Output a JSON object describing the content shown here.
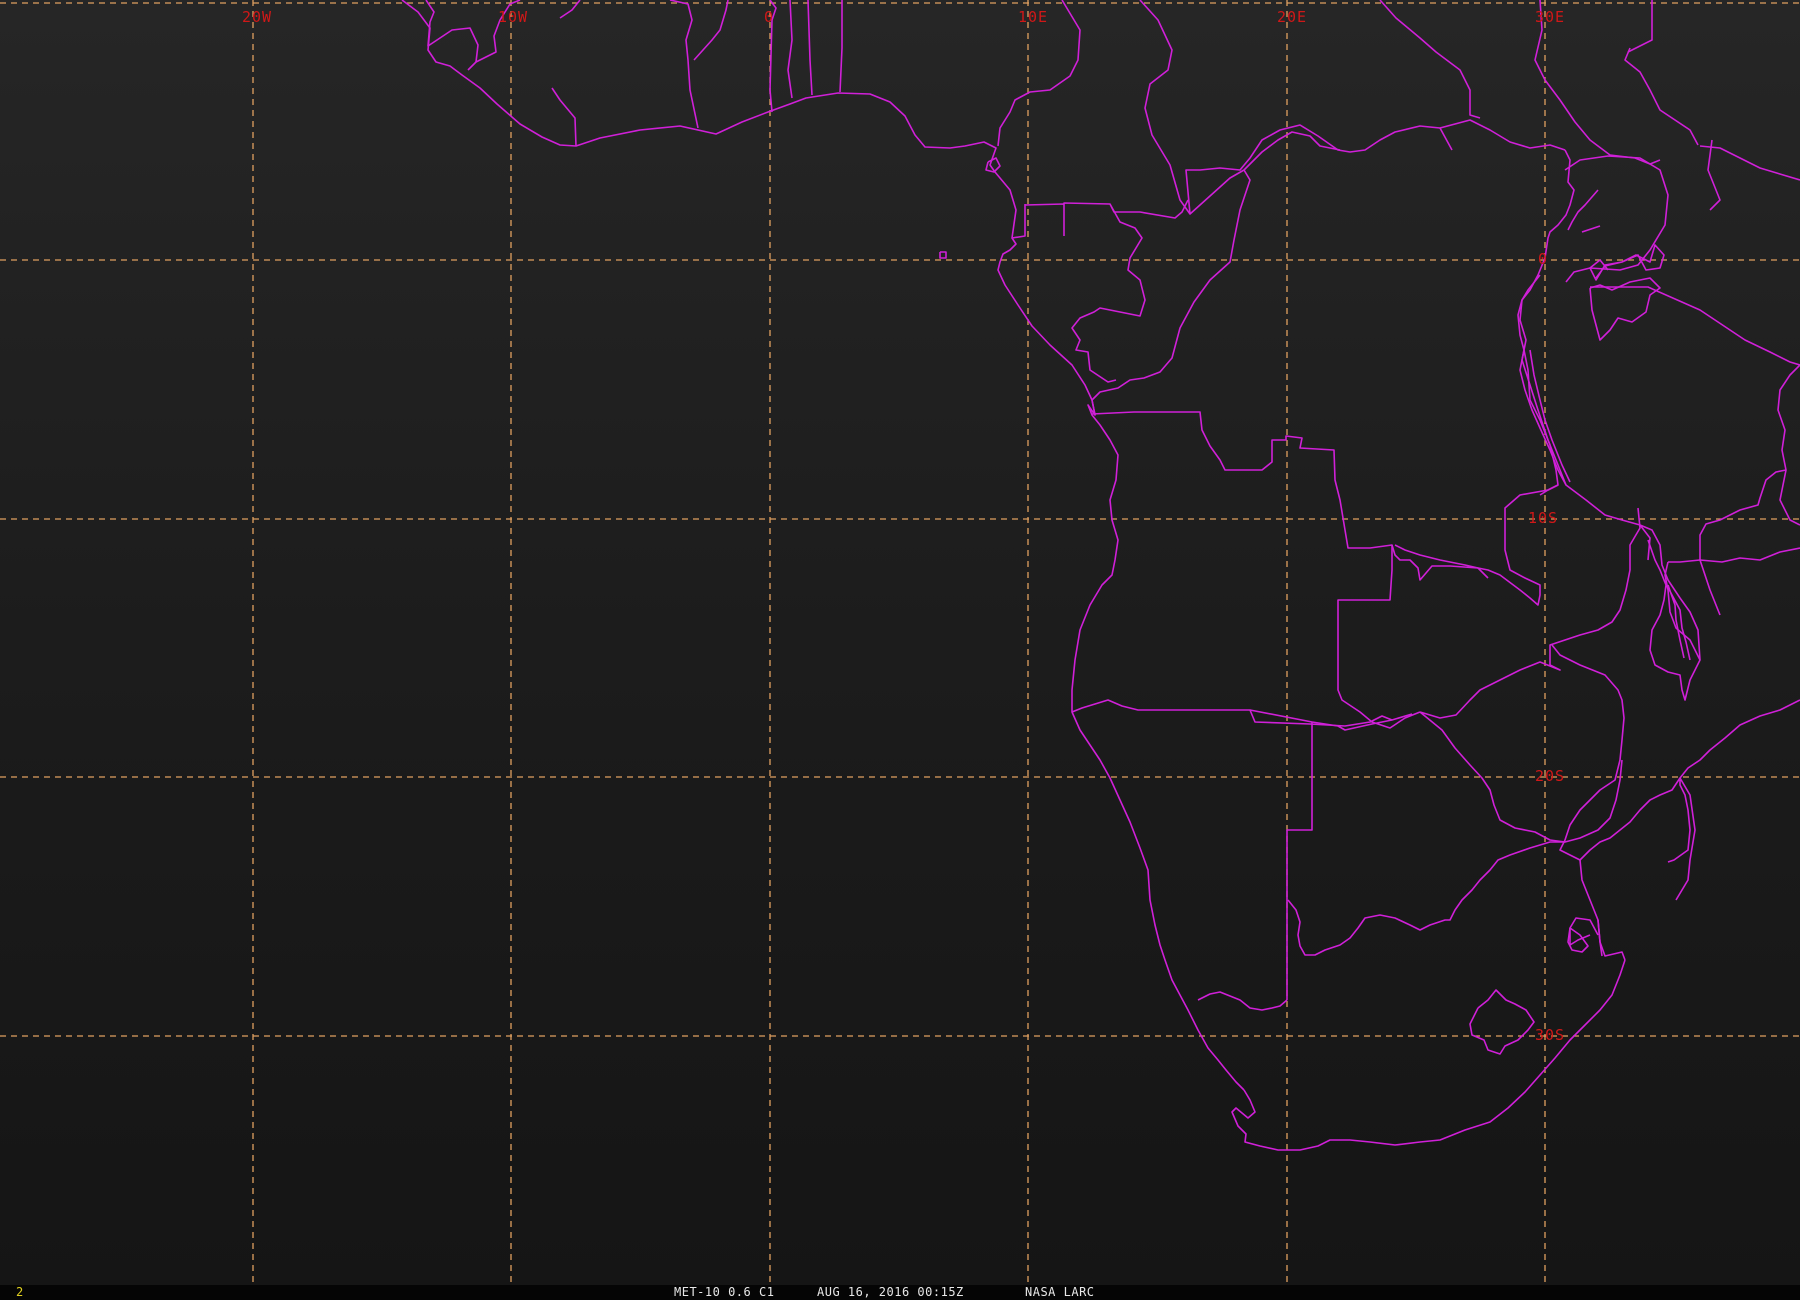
{
  "map": {
    "title": "MET-10 0.6 C1",
    "datetime": "AUG 16, 2016 00:15Z",
    "source": "NASA LARC",
    "frame_number": "2",
    "colors": {
      "background": "#1a1a1a",
      "grid": "#e0a060",
      "border": "#d020d8",
      "label": "#d01818"
    },
    "meridians": [
      {
        "lon": -20,
        "label": "20W"
      },
      {
        "lon": -10,
        "label": "10W"
      },
      {
        "lon": 0,
        "label": "0"
      },
      {
        "lon": 10,
        "label": "10E"
      },
      {
        "lon": 20,
        "label": "20E"
      },
      {
        "lon": 30,
        "label": "30E"
      }
    ],
    "parallels": [
      {
        "lat": 0,
        "label": "0"
      },
      {
        "lat": -10,
        "label": "10S"
      },
      {
        "lat": -20,
        "label": "20S"
      },
      {
        "lat": -30,
        "label": "30S"
      }
    ]
  }
}
